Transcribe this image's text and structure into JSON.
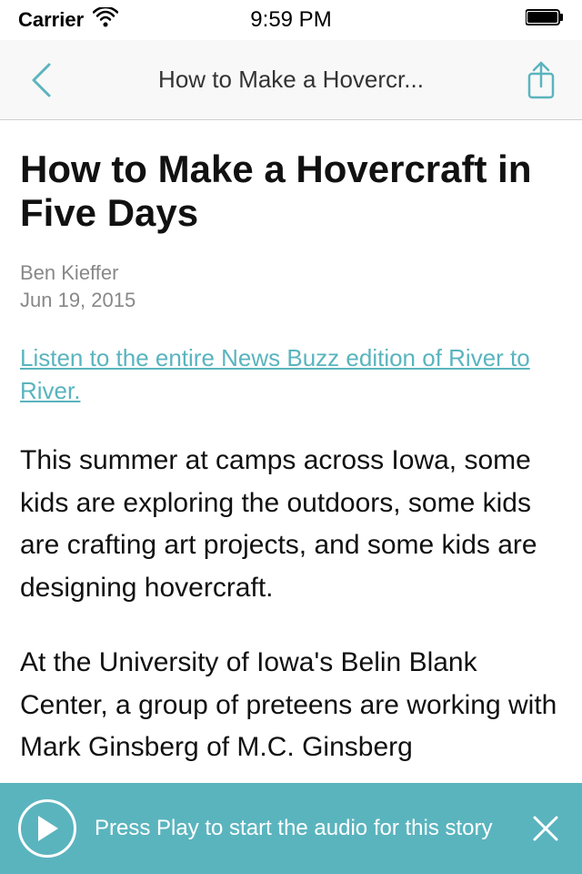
{
  "status_bar": {
    "carrier": "Carrier",
    "time": "9:59 PM"
  },
  "nav": {
    "title": "How to Make a Hovercr...",
    "back_label": "<",
    "share_label": "share"
  },
  "article": {
    "title": "How to Make a Hovercraft in Five Days",
    "author": "Ben Kieffer",
    "date": "Jun 19, 2015",
    "link_text": "Listen to the entire News Buzz edition of River to River.",
    "body_p1": "This summer at camps across Iowa, some kids are exploring the outdoors, some kids are crafting art projects, and some kids are designing hovercraft.",
    "body_p2": "At the University of Iowa's Belin Blank Center, a group of preteens are working with Mark Ginsberg of M.C. Ginsberg"
  },
  "play_bar": {
    "text": "Press Play to start the audio for this story"
  },
  "colors": {
    "link": "#5ab4be",
    "play_bar_bg": "#5ab4be"
  }
}
